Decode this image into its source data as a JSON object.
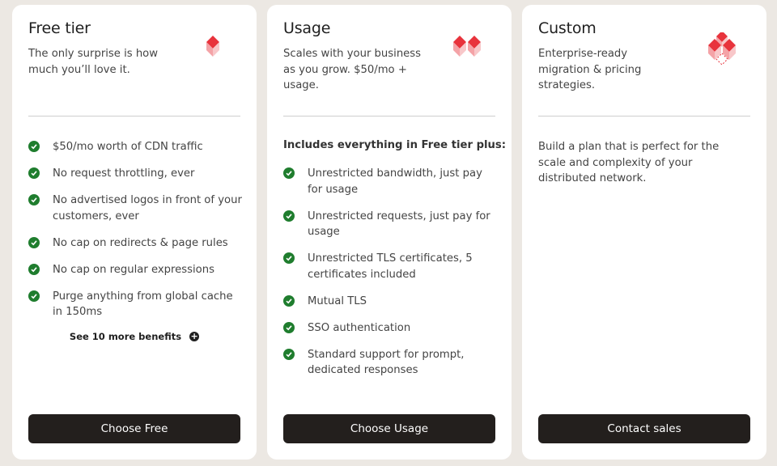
{
  "plans": {
    "free": {
      "title": "Free tier",
      "subtitle": "The only surprise is how much you’ll love it.",
      "benefits": [
        "$50/mo worth of CDN traffic",
        "No request throttling, ever",
        "No advertised logos in front of your customers, ever",
        "No cap on redirects & page rules",
        "No cap on regular expressions",
        "Purge anything from global cache in 150ms"
      ],
      "more_label": "See 10 more benefits",
      "cta": "Choose Free"
    },
    "usage": {
      "title": "Usage",
      "subtitle": "Scales with your business as you grow. $50/mo + usage.",
      "includes": "Includes everything in Free tier plus:",
      "benefits": [
        "Unrestricted bandwidth, just pay for usage",
        "Unrestricted requests, just pay for usage",
        "Unrestricted TLS certificates, 5 certificates included",
        "Mutual TLS",
        "SSO authentication",
        "Standard support for prompt, dedicated responses"
      ],
      "cta": "Choose Usage"
    },
    "custom": {
      "title": "Custom",
      "subtitle": "Enterprise-ready migration & pricing strategies.",
      "description": "Build a plan that is perfect for the scale and complexity of your distributed network.",
      "cta": "Contact sales"
    }
  },
  "colors": {
    "background": "#ece8e3",
    "card": "#ffffff",
    "check": "#1f7d2e",
    "button": "#231f1d",
    "logo_red": "#e8333c",
    "logo_pink": "#f6b5b8"
  },
  "icons": {
    "check": "check-circle-icon",
    "more": "plus-circle-icon",
    "free_logo": "single-cube-logo",
    "usage_logo": "double-cube-logo",
    "custom_logo": "cube-stack-logo"
  }
}
